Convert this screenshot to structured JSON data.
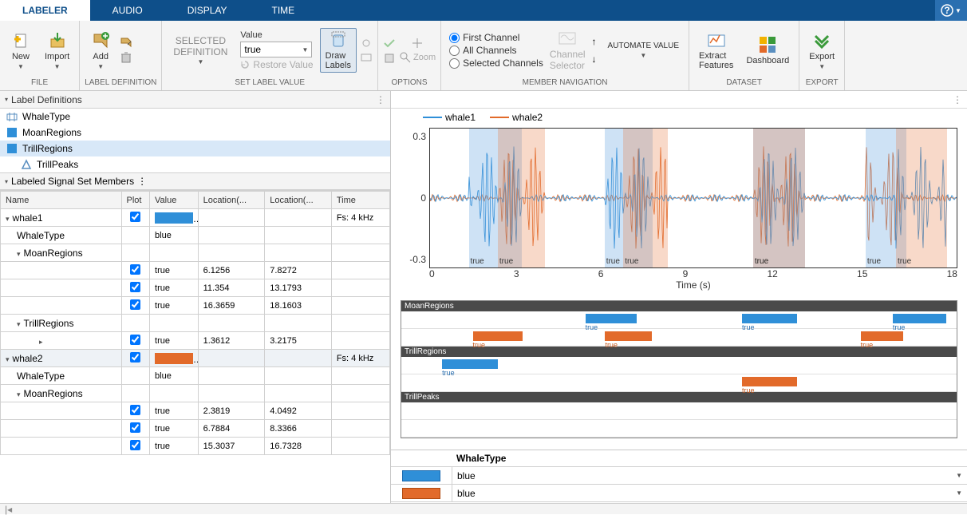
{
  "tabs": {
    "labeler": "LABELER",
    "audio": "AUDIO",
    "display": "DISPLAY",
    "time": "TIME"
  },
  "ribbon": {
    "file": {
      "new": "New",
      "import": "Import",
      "label": "FILE"
    },
    "labeldef": {
      "add": "Add",
      "label": "LABEL DEFINITION"
    },
    "selected_def": {
      "line1": "SELECTED",
      "line2": "DEFINITION"
    },
    "setlabel": {
      "value_lbl": "Value",
      "value": "true",
      "restore": "Restore Value",
      "draw": "Draw\nLabels",
      "label": "SET LABEL VALUE"
    },
    "options": {
      "zoom": "Zoom",
      "label": "OPTIONS"
    },
    "nav": {
      "first": "First Channel",
      "all": "All Channels",
      "sel": "Selected Channels",
      "chan": "Channel\nSelector",
      "auto": "AUTOMATE VALUE",
      "label": "MEMBER NAVIGATION"
    },
    "dataset": {
      "extract": "Extract\nFeatures",
      "dash": "Dashboard",
      "label": "DATASET"
    },
    "export": {
      "export": "Export",
      "label": "EXPORT"
    }
  },
  "left": {
    "defs_hdr": "Label Definitions",
    "defs": [
      "WhaleType",
      "MoanRegions",
      "TrillRegions",
      "TrillPeaks"
    ],
    "members_hdr": "Labeled Signal Set Members",
    "cols": {
      "name": "Name",
      "plot": "Plot",
      "value": "Value",
      "locmin": "Location(...",
      "locmax": "Location(...",
      "time": "Time"
    },
    "rows": [
      {
        "name": "whale1",
        "plot": true,
        "swatch": "#2f8fd8",
        "time": "Fs: 4 kHz",
        "exp": true,
        "lvl": 0
      },
      {
        "name": "WhaleType",
        "value": "blue",
        "lvl": 1
      },
      {
        "name": "MoanRegions",
        "exp": true,
        "lvl": 1
      },
      {
        "plot": true,
        "value": "true",
        "locmin": "6.1256",
        "locmax": "7.8272",
        "lvl": 2
      },
      {
        "plot": true,
        "value": "true",
        "locmin": "11.354",
        "locmax": "13.1793",
        "lvl": 2
      },
      {
        "plot": true,
        "value": "true",
        "locmin": "16.3659",
        "locmax": "18.1603",
        "lvl": 2
      },
      {
        "name": "TrillRegions",
        "exp": true,
        "lvl": 1
      },
      {
        "plot": true,
        "value": "true",
        "locmin": "1.3612",
        "locmax": "3.2175",
        "lvl": 3,
        "col": true
      },
      {
        "name": "whale2",
        "plot": true,
        "swatch": "#e26a2a",
        "time": "Fs: 4 kHz",
        "exp": true,
        "lvl": 0,
        "sel": true
      },
      {
        "name": "WhaleType",
        "value": "blue",
        "lvl": 1
      },
      {
        "name": "MoanRegions",
        "exp": true,
        "lvl": 1
      },
      {
        "plot": true,
        "value": "true",
        "locmin": "2.3819",
        "locmax": "4.0492",
        "lvl": 2
      },
      {
        "plot": true,
        "value": "true",
        "locmin": "6.7884",
        "locmax": "8.3366",
        "lvl": 2
      },
      {
        "plot": true,
        "value": "true",
        "locmin": "15.3037",
        "locmax": "16.7328",
        "lvl": 2
      }
    ]
  },
  "plot": {
    "legend": {
      "s1": "whale1",
      "s2": "whale2"
    },
    "yticks": [
      "0.3",
      "0",
      "-0.3"
    ],
    "xticks": [
      "0",
      "3",
      "6",
      "9",
      "12",
      "15",
      "18"
    ],
    "xlabel": "Time (s)",
    "regions": [
      {
        "series": "blue",
        "start": 1.36,
        "end": 3.22,
        "label": "true"
      },
      {
        "series": "orange",
        "start": 2.38,
        "end": 4.05,
        "label": "true"
      },
      {
        "series": "blue",
        "start": 6.13,
        "end": 7.83,
        "label": "true"
      },
      {
        "series": "orange",
        "start": 6.79,
        "end": 8.34,
        "label": "true"
      },
      {
        "series": "blue",
        "start": 11.35,
        "end": 13.18,
        "label": "true"
      },
      {
        "series": "orange",
        "start": 11.35,
        "end": 13.18,
        "label": "true"
      },
      {
        "series": "blue",
        "start": 15.3,
        "end": 16.73,
        "label": "true"
      },
      {
        "series": "orange",
        "start": 16.37,
        "end": 18.16,
        "label": "true"
      }
    ],
    "xmax": 18.5
  },
  "tracks": {
    "moan": "MoanRegions",
    "trill": "TrillRegions",
    "peaks": "TrillPeaks",
    "truelbl": "true",
    "moan_blue": [
      [
        6.13,
        7.83
      ],
      [
        11.35,
        13.18
      ],
      [
        16.37,
        18.16
      ]
    ],
    "moan_orange": [
      [
        2.38,
        4.05
      ],
      [
        6.79,
        8.34
      ],
      [
        15.3,
        16.73
      ]
    ],
    "trill_blue": [
      [
        1.36,
        3.22
      ]
    ],
    "trill_orange": [
      [
        11.35,
        13.18
      ]
    ]
  },
  "whaletype": {
    "hdr": "WhaleType",
    "val": "blue"
  },
  "chart_data": {
    "type": "line",
    "title": "",
    "xlabel": "Time (s)",
    "ylabel": "",
    "xlim": [
      0,
      18.5
    ],
    "ylim": [
      -0.35,
      0.35
    ],
    "series": [
      {
        "name": "whale1",
        "color": "#2f8fd8",
        "regions_true": [
          [
            1.3612,
            3.2175
          ],
          [
            6.1256,
            7.8272
          ],
          [
            11.354,
            13.1793
          ],
          [
            16.3659,
            18.1603
          ]
        ]
      },
      {
        "name": "whale2",
        "color": "#e26a2a",
        "regions_true": [
          [
            2.3819,
            4.0492
          ],
          [
            6.7884,
            8.3366
          ],
          [
            11.354,
            13.1793
          ],
          [
            15.3037,
            16.7328
          ]
        ]
      }
    ],
    "note": "waveform amplitude oscillates roughly ±0.3 inside labeled regions, near 0 outside"
  }
}
